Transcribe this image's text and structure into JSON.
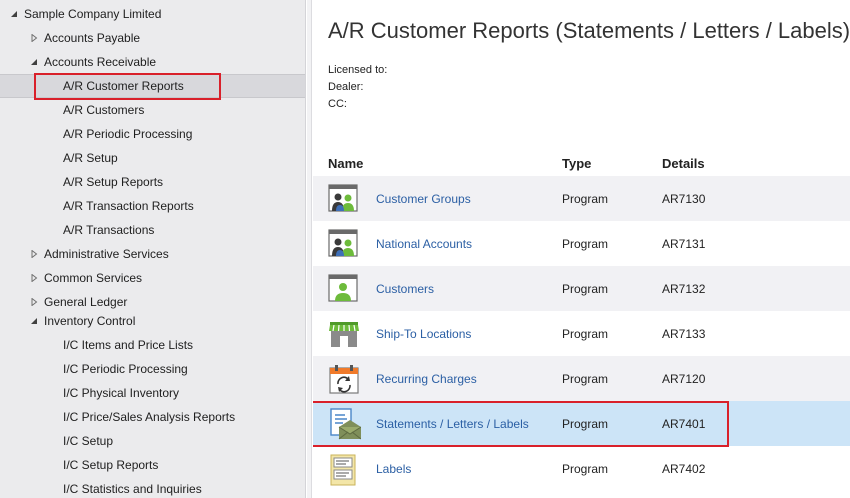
{
  "tree": {
    "items": [
      {
        "label": "Sample Company Limited",
        "expander": "expanded"
      },
      {
        "label": "Accounts Payable",
        "expander": "collapsed"
      },
      {
        "label": "Accounts Receivable",
        "expander": "expanded"
      },
      {
        "label": "A/R Customer Reports",
        "expander": "none"
      },
      {
        "label": "A/R Customers",
        "expander": "none"
      },
      {
        "label": "A/R Periodic Processing",
        "expander": "none"
      },
      {
        "label": "A/R Setup",
        "expander": "none"
      },
      {
        "label": "A/R Setup Reports",
        "expander": "none"
      },
      {
        "label": "A/R Transaction Reports",
        "expander": "none"
      },
      {
        "label": "A/R Transactions",
        "expander": "none"
      },
      {
        "label": "Administrative Services",
        "expander": "collapsed"
      },
      {
        "label": "Common Services",
        "expander": "collapsed"
      },
      {
        "label": "General Ledger",
        "expander": "collapsed"
      },
      {
        "label": "Inventory Control",
        "expander": "expanded"
      },
      {
        "label": "I/C Items and Price Lists",
        "expander": "none"
      },
      {
        "label": "I/C Periodic Processing",
        "expander": "none"
      },
      {
        "label": "I/C Physical Inventory",
        "expander": "none"
      },
      {
        "label": "I/C Price/Sales Analysis Reports",
        "expander": "none"
      },
      {
        "label": "I/C Setup",
        "expander": "none"
      },
      {
        "label": "I/C Setup Reports",
        "expander": "none"
      },
      {
        "label": "I/C Statistics and Inquiries",
        "expander": "none"
      }
    ],
    "selected_label": "A/R Customer Reports"
  },
  "main": {
    "title": "A/R Customer Reports (Statements / Letters / Labels)",
    "licensed_to": "Licensed to:",
    "dealer": "Dealer:",
    "cc": "CC:",
    "columns": {
      "name": "Name",
      "type": "Type",
      "details": "Details"
    },
    "rows": [
      {
        "name": "Customer Groups",
        "type": "Program",
        "details": "AR7130",
        "icon": "customer-groups-icon"
      },
      {
        "name": "National Accounts",
        "type": "Program",
        "details": "AR7131",
        "icon": "national-accounts-icon"
      },
      {
        "name": "Customers",
        "type": "Program",
        "details": "AR7132",
        "icon": "customers-icon"
      },
      {
        "name": "Ship-To Locations",
        "type": "Program",
        "details": "AR7133",
        "icon": "storefront-icon"
      },
      {
        "name": "Recurring Charges",
        "type": "Program",
        "details": "AR7120",
        "icon": "calendar-recurring-icon"
      },
      {
        "name": "Statements / Letters / Labels",
        "type": "Program",
        "details": "AR7401",
        "icon": "document-envelope-icon"
      },
      {
        "name": "Labels",
        "type": "Program",
        "details": "AR7402",
        "icon": "labels-icon"
      }
    ],
    "selected_row": "Statements / Letters / Labels"
  },
  "colors": {
    "highlight_box": "#d9202a",
    "link_text": "#2b5fa4",
    "selected_row": "#cce4f7",
    "tree_background": "#ebebed"
  }
}
